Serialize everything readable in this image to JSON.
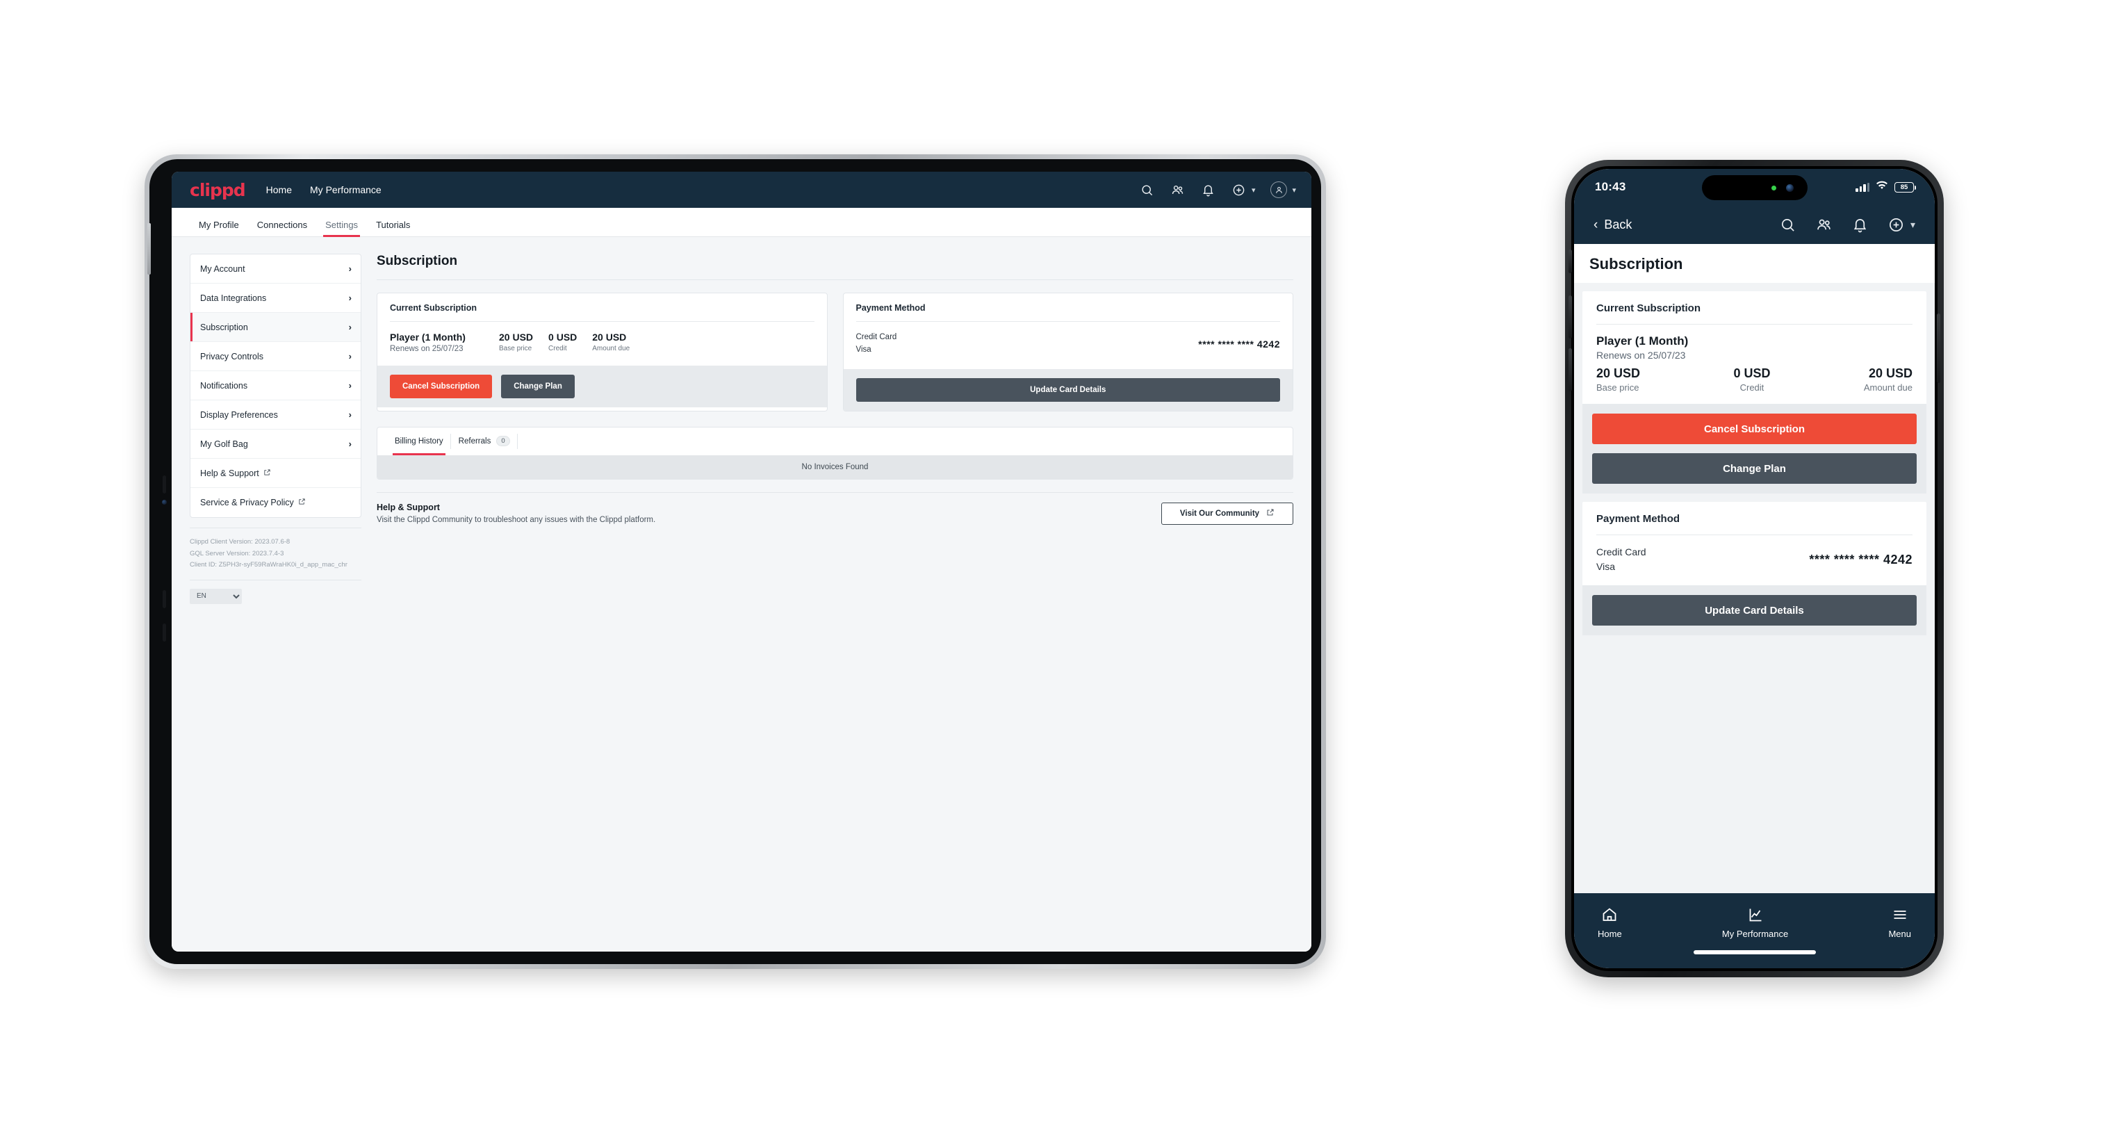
{
  "brand": {
    "logo": "clippd",
    "accent": "#e8344e",
    "header_bg": "#162d3f",
    "danger": "#ee4b37",
    "dark_btn": "#49535d"
  },
  "tablet": {
    "header": {
      "links": [
        "Home",
        "My Performance"
      ],
      "icons": [
        "search-icon",
        "people-icon",
        "bell-icon",
        "plus-circle-icon",
        "avatar-icon"
      ]
    },
    "tabs": [
      {
        "label": "My Profile",
        "active": false
      },
      {
        "label": "Connections",
        "active": false
      },
      {
        "label": "Settings",
        "active": true
      },
      {
        "label": "Tutorials",
        "active": false
      }
    ],
    "sidebar": {
      "items": [
        {
          "label": "My Account",
          "type": "chevron",
          "active": false
        },
        {
          "label": "Data Integrations",
          "type": "chevron",
          "active": false
        },
        {
          "label": "Subscription",
          "type": "chevron",
          "active": true
        },
        {
          "label": "Privacy Controls",
          "type": "chevron",
          "active": false
        },
        {
          "label": "Notifications",
          "type": "chevron",
          "active": false
        },
        {
          "label": "Display Preferences",
          "type": "chevron",
          "active": false
        },
        {
          "label": "My Golf Bag",
          "type": "chevron",
          "active": false
        },
        {
          "label": "Help & Support",
          "type": "external",
          "active": false
        },
        {
          "label": "Service & Privacy Policy",
          "type": "external",
          "active": false
        }
      ],
      "version": {
        "client": "Clippd Client Version: 2023.07.6-8",
        "server": "GQL Server Version: 2023.7.4-3",
        "client_id": "Client ID: Z5PH3r-syF59RaWraHK0i_d_app_mac_chr"
      },
      "language": {
        "selected": "EN",
        "options": [
          "EN"
        ]
      }
    },
    "main": {
      "page_title": "Subscription",
      "current_subscription": {
        "title": "Current Subscription",
        "plan_name": "Player (1 Month)",
        "renews": "Renews on 25/07/23",
        "stats": [
          {
            "value": "20 USD",
            "label": "Base price"
          },
          {
            "value": "0 USD",
            "label": "Credit"
          },
          {
            "value": "20 USD",
            "label": "Amount due"
          }
        ],
        "cancel_label": "Cancel Subscription",
        "change_label": "Change Plan"
      },
      "payment_method": {
        "title": "Payment Method",
        "type": "Credit Card",
        "brand": "Visa",
        "number": "**** **** **** 4242",
        "update_label": "Update Card Details"
      },
      "history": {
        "tabs": [
          {
            "label": "Billing History",
            "badge": null,
            "active": true
          },
          {
            "label": "Referrals",
            "badge": "0",
            "active": false
          }
        ],
        "empty": "No Invoices Found"
      },
      "help": {
        "title": "Help & Support",
        "subtitle": "Visit the Clippd Community to troubleshoot any issues with the Clippd platform.",
        "button": "Visit Our Community"
      }
    }
  },
  "phone": {
    "status": {
      "time": "10:43",
      "battery": "85"
    },
    "nav": {
      "back": "Back",
      "icons": [
        "search-icon",
        "people-icon",
        "bell-icon",
        "plus-circle-icon"
      ]
    },
    "page_title": "Subscription",
    "current_subscription": {
      "title": "Current Subscription",
      "plan_name": "Player (1 Month)",
      "renews": "Renews on 25/07/23",
      "stats": [
        {
          "value": "20 USD",
          "label": "Base price"
        },
        {
          "value": "0 USD",
          "label": "Credit"
        },
        {
          "value": "20 USD",
          "label": "Amount due"
        }
      ],
      "cancel_label": "Cancel Subscription",
      "change_label": "Change Plan"
    },
    "payment_method": {
      "title": "Payment Method",
      "type": "Credit Card",
      "brand": "Visa",
      "number": "**** **** **** 4242",
      "update_label": "Update Card Details"
    },
    "tabbar": [
      {
        "label": "Home",
        "icon": "home-icon"
      },
      {
        "label": "My Performance",
        "icon": "chart-icon"
      },
      {
        "label": "Menu",
        "icon": "hamburger-icon"
      }
    ]
  }
}
